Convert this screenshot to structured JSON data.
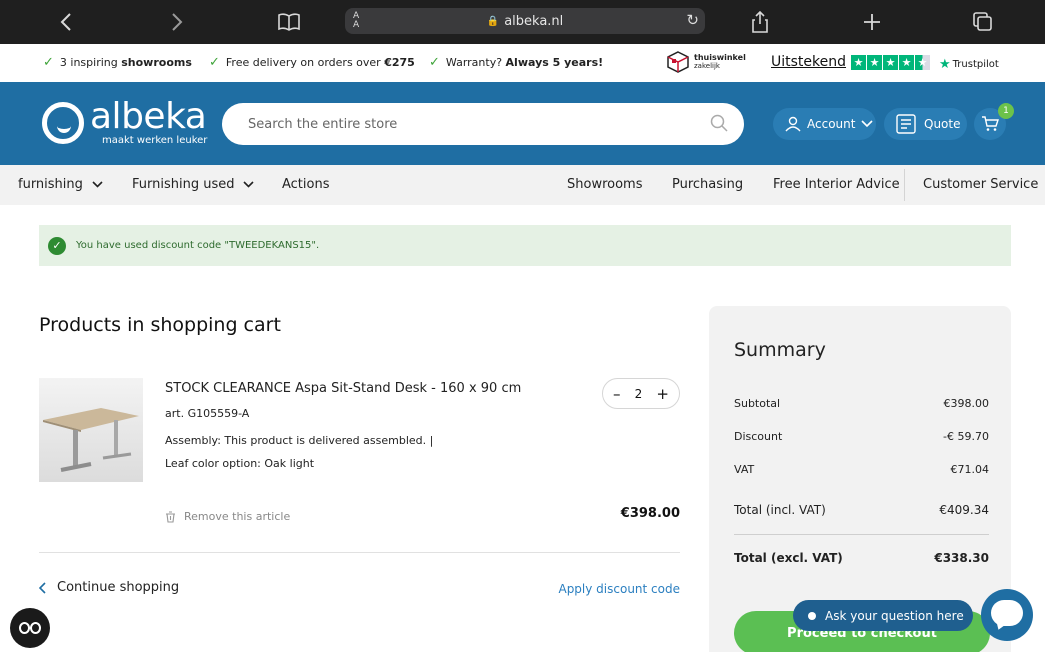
{
  "browser": {
    "url": "albeka.nl",
    "aa_label": "AA"
  },
  "usp": {
    "item1_plain": "3 inspiring ",
    "item1_bold": "showrooms",
    "item2_plain": "Free delivery on orders over ",
    "item2_bold": "€275",
    "item3_plain": "Warranty? ",
    "item3_bold": "Always 5 years!",
    "thuiswinkel_line1": "thuiswinkel",
    "thuiswinkel_line2": "zakelijk",
    "rating_word": "Uitstekend",
    "trustpilot_label": "Trustpilot"
  },
  "header": {
    "logo_name": "albeka",
    "logo_tagline": "maakt werken leuker",
    "search_placeholder": "Search the entire store",
    "account_label": "Account",
    "quote_label": "Quote",
    "cart_count": "1"
  },
  "nav": {
    "left": [
      "furnishing",
      "Furnishing used",
      "Actions"
    ],
    "right": [
      "Showrooms",
      "Purchasing",
      "Free Interior Advice",
      "Customer Service"
    ]
  },
  "alert": {
    "message": "You have used discount code \"TWEEDEKANS15\"."
  },
  "cart": {
    "heading": "Products in shopping cart",
    "item": {
      "name": "STOCK CLEARANCE Aspa Sit-Stand Desk - 160 x 90 cm",
      "article": "art. G105559-A",
      "option1": "Assembly: This product is delivered assembled. |",
      "option2": "Leaf color option: Oak light",
      "quantity": "2",
      "remove_label": "Remove this article",
      "price": "€398.00"
    },
    "continue_label": "Continue shopping",
    "apply_discount_label": "Apply discount code"
  },
  "summary": {
    "title": "Summary",
    "subtotal_label": "Subtotal",
    "subtotal_value": "€398.00",
    "discount_label": "Discount",
    "discount_value": "-€ 59.70",
    "vat_label": "VAT",
    "vat_value": "€71.04",
    "total_incl_label": "Total (incl. VAT)",
    "total_incl_value": "€409.34",
    "total_excl_label": "Total (excl. VAT)",
    "total_excl_value": "€338.30",
    "checkout_label": "Proceed to checkout"
  },
  "chat": {
    "label": "Ask your question here"
  },
  "colors": {
    "brand_blue": "#1f6ea3",
    "success_green": "#5bbf53",
    "trustpilot_green": "#00b67a",
    "link_blue": "#2b7fc0"
  },
  "icons": [
    "back-icon",
    "forward-icon",
    "bookmarks-icon",
    "lock-icon",
    "reload-icon",
    "share-icon",
    "new-tab-icon",
    "tabs-icon",
    "check-icon",
    "thuiswinkel-logo",
    "trustpilot-star-icon",
    "search-icon",
    "user-icon",
    "quote-icon",
    "cart-icon",
    "chevron-down-icon",
    "success-check-icon",
    "minus-icon",
    "plus-icon",
    "trash-icon",
    "chevron-left-icon",
    "chat-icon",
    "reader-icon"
  ]
}
